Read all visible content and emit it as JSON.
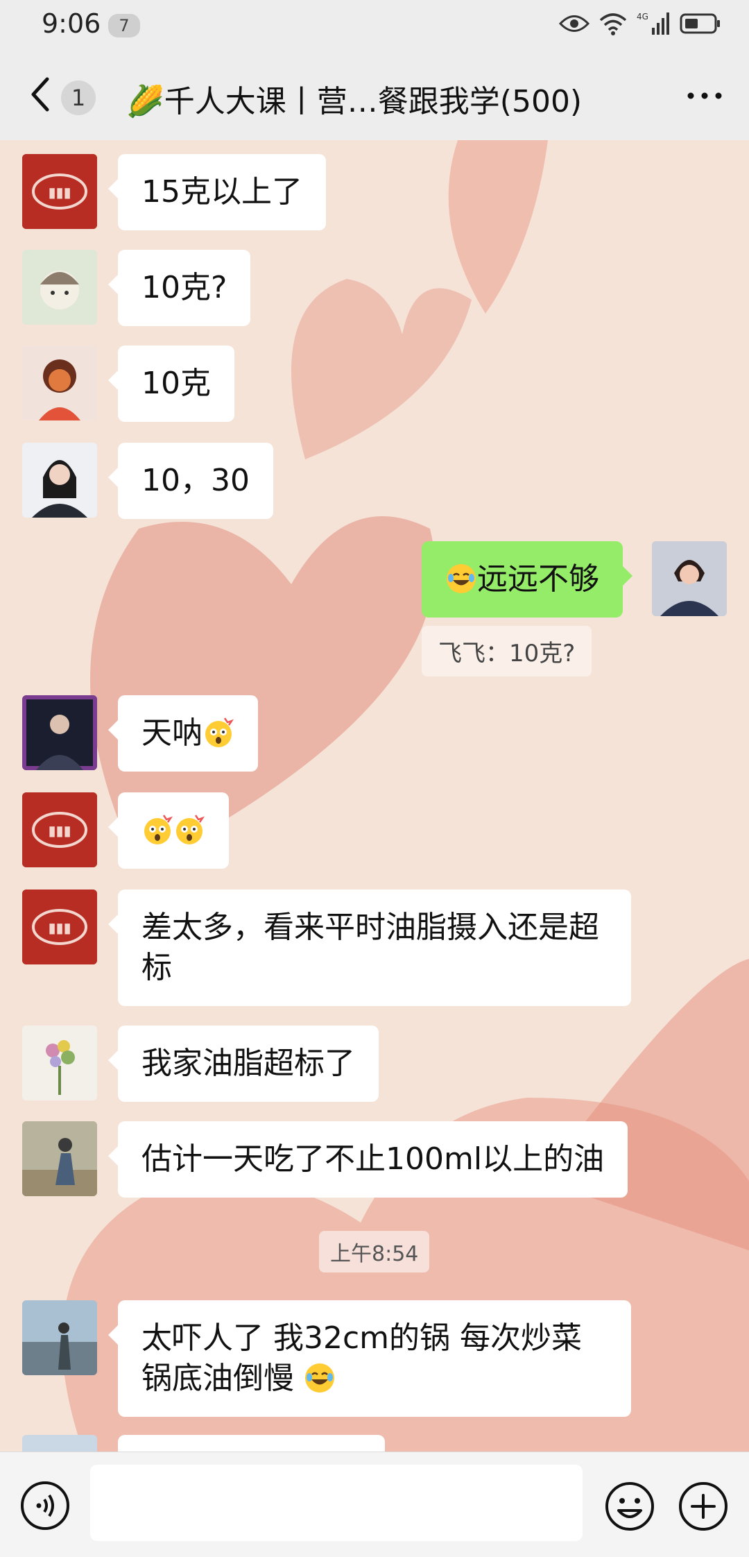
{
  "status_bar": {
    "time": "9:06",
    "badge": "7",
    "network": "4G"
  },
  "header": {
    "back_count": "1",
    "title": "🌽千人大课丨营…餐跟我学(500)"
  },
  "messages": [
    {
      "text": "15克以上了"
    },
    {
      "text": "10克?"
    },
    {
      "text": "10克"
    },
    {
      "text": "10，30"
    },
    {
      "text": "远远不够",
      "prefix_emoji": "laughing-tears"
    },
    {
      "quote": "飞飞：10克?"
    },
    {
      "text": "天呐",
      "suffix_emoji": "astonished"
    },
    {
      "text": "",
      "emojis": [
        "astonished",
        "astonished"
      ]
    },
    {
      "text": "差太多，看来平时油脂摄入还是超标"
    },
    {
      "text": "我家油脂超标了"
    },
    {
      "text": "估计一天吃了不止100ml以上的油"
    },
    {
      "time": "上午8:54"
    },
    {
      "text": "太吓人了 我32cm的锅 每次炒菜锅底油倒慢",
      "suffix_emoji": "laughing-tears"
    }
  ],
  "input": {
    "placeholder": ""
  },
  "colors": {
    "bubble_self": "#95ec69",
    "bubble_other": "#ffffff",
    "chat_bg": "#f6e3d8"
  }
}
